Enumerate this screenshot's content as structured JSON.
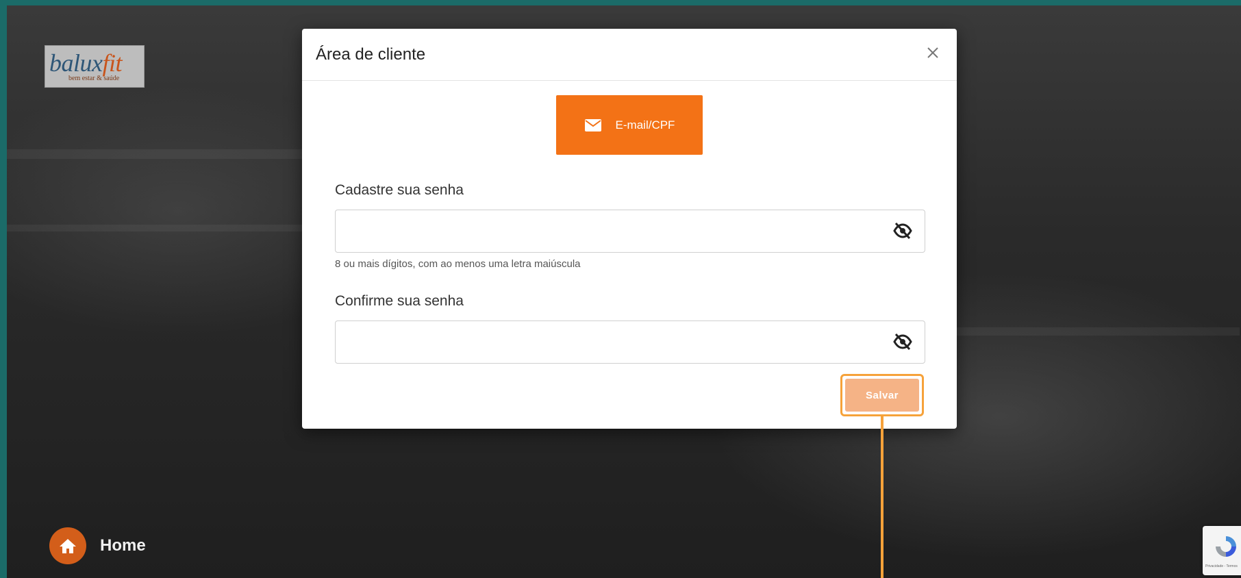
{
  "brand": {
    "logo_main": "balux",
    "logo_accent": "fit",
    "logo_tagline": "bem estar & saúde"
  },
  "nav": {
    "home_label": "Home",
    "home_icon": "home-icon"
  },
  "recaptcha": {
    "footer_text": "Privacidade - Termos"
  },
  "modal": {
    "title": "Área de cliente",
    "close_icon": "close-icon",
    "login_tab": {
      "label": "E-mail/CPF",
      "icon": "envelope-icon",
      "color": "#f37216"
    },
    "password_field": {
      "label": "Cadastre sua senha",
      "value": "",
      "hint": "8 ou mais dígitos, com ao menos uma letra maiúscula",
      "icon": "eye-slash-icon"
    },
    "confirm_field": {
      "label": "Confirme sua senha",
      "value": "",
      "icon": "eye-slash-icon"
    },
    "save_button": {
      "label": "Salvar",
      "state": "disabled",
      "color": "#f5b386"
    }
  },
  "colors": {
    "accent": "#f37216",
    "highlight": "#f6a23a",
    "page_border": "#1b6b68"
  }
}
